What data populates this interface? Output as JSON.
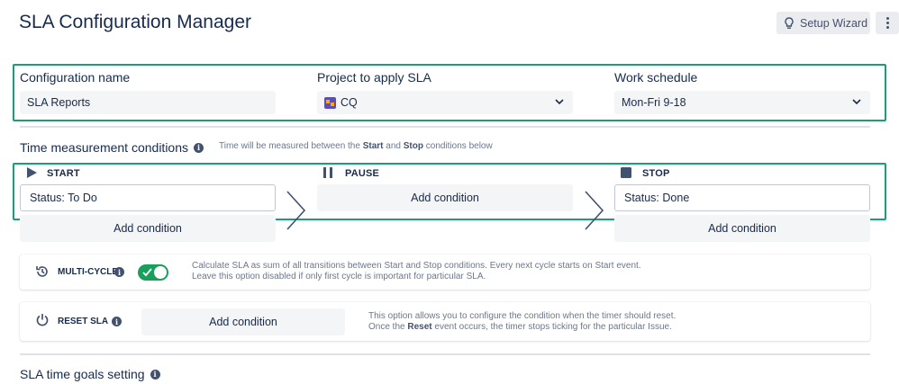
{
  "page": {
    "title": "SLA Configuration Manager"
  },
  "header": {
    "setup_wizard_label": "Setup Wizard"
  },
  "config": {
    "name_label": "Configuration name",
    "name_value": "SLA Reports",
    "project_label": "Project to apply SLA",
    "project_value": "CQ",
    "schedule_label": "Work schedule",
    "schedule_value": "Mon-Fri 9-18"
  },
  "time_conditions": {
    "title": "Time measurement conditions",
    "hint_prefix": "Time will be measured between the",
    "hint_start": "Start",
    "hint_and": "and",
    "hint_stop": "Stop",
    "hint_suffix": "conditions below",
    "start": {
      "label": "START",
      "condition": "Status: To Do",
      "add_label": "Add condition"
    },
    "pause": {
      "label": "PAUSE",
      "add_label": "Add condition"
    },
    "stop": {
      "label": "STOP",
      "condition": "Status: Done",
      "add_label": "Add condition"
    }
  },
  "multicycle": {
    "label": "MULTI-CYCLE",
    "enabled": true,
    "desc_line1": "Calculate SLA as sum of all transitions between Start and Stop conditions. Every next cycle starts on Start event.",
    "desc_line2": "Leave this option disabled if only first cycle is important for particular SLA."
  },
  "reset": {
    "label": "RESET SLA",
    "add_label": "Add condition",
    "desc_line1": "This option allows you to configure the condition when the timer should reset.",
    "desc_line2_prefix": "Once the",
    "desc_line2_bold": "Reset",
    "desc_line2_suffix": "event occurs, the timer stops ticking for the particular Issue."
  },
  "goals": {
    "title": "SLA time goals setting"
  },
  "colors": {
    "highlight": "#1a9e77",
    "toggle_on": "#1a9e5c",
    "text": "#172b4d"
  }
}
